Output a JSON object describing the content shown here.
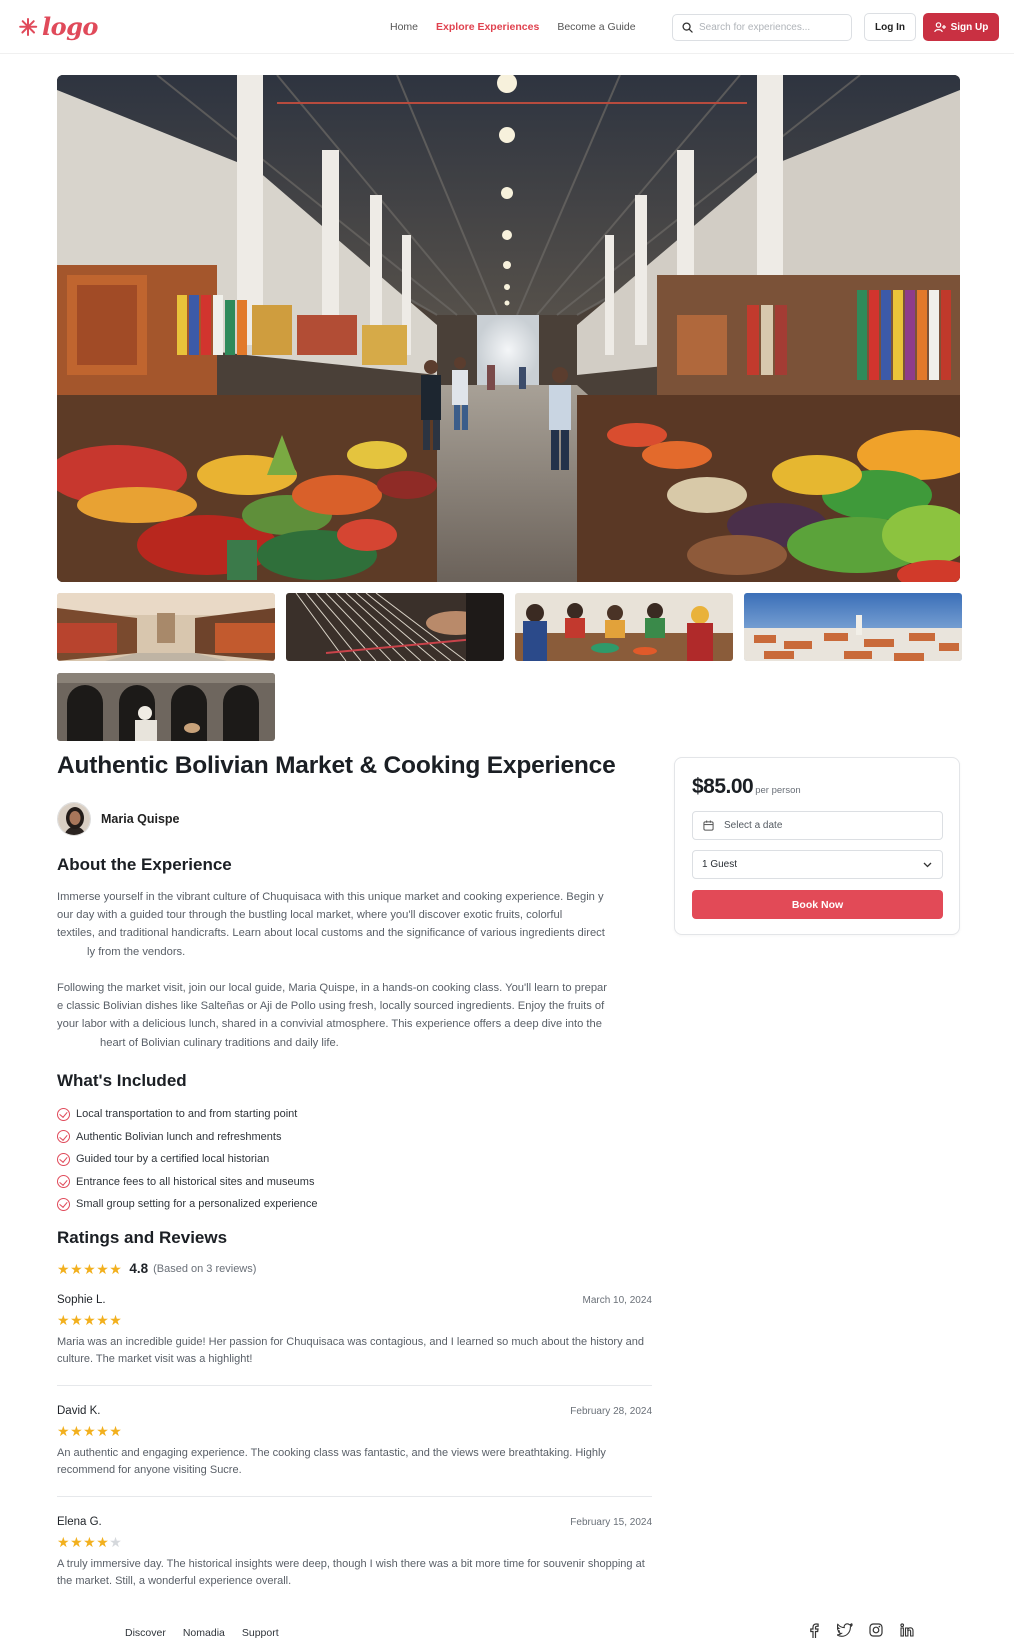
{
  "nav": {
    "logo_text": "logo",
    "links": [
      "Home",
      "Explore Experiences",
      "Become a Guide"
    ],
    "search_placeholder": "Search for experiences...",
    "login_label": "Log In",
    "signup_label": "Sign Up"
  },
  "experience": {
    "title": "Authentic Bolivian Market & Cooking Experience",
    "guide_name": "Maria Quispe"
  },
  "about": {
    "heading": "About the Experience",
    "paragraph_1_lines": [
      "Immerse yourself in the vibrant culture of Chuquisaca with this unique market and cooking experience. Begin y",
      "our day with a guided tour through the bustling local market, where you'll discover exotic fruits, colorful",
      "textiles, and traditional handicrafts. Learn about local customs and the significance of various ingredients direct",
      "ly from the vendors."
    ],
    "paragraph_2_lines": [
      "Following the market visit, join our local guide, Maria Quispe, in a hands-on cooking class. You'll learn to prepar",
      "e classic Bolivian dishes like Salteñas or Aji de Pollo using fresh, locally sourced ingredients. Enjoy the fruits of",
      "your labor with a delicious lunch, shared in a convivial atmosphere. This experience offers a deep dive into the",
      "heart of Bolivian culinary traditions and daily life."
    ]
  },
  "included": {
    "heading": "What's Included",
    "items": [
      "Local transportation to and from starting point",
      "Authentic Bolivian lunch and refreshments",
      "Guided tour by a certified local historian",
      "Entrance fees to all historical sites and museums",
      "Small group setting for a personalized experience"
    ]
  },
  "ratings": {
    "heading": "Ratings and Reviews",
    "average": "4.8",
    "average_stars": 5,
    "count_text": "(Based on 3 reviews)",
    "reviews": [
      {
        "name": "Sophie L.",
        "date": "March 10, 2024",
        "stars": 5,
        "text": "Maria was an incredible guide! Her passion for Chuquisaca was contagious, and I learned so much about the history and culture. The market visit was a highlight!"
      },
      {
        "name": "David K.",
        "date": "February 28, 2024",
        "stars": 5,
        "text": "An authentic and engaging experience. The cooking class was fantastic, and the views were breathtaking. Highly recommend for anyone visiting Sucre."
      },
      {
        "name": "Elena G.",
        "date": "February 15, 2024",
        "stars": 4,
        "text": "A truly immersive day. The historical insights were deep, though I wish there was a bit more time for souvenir shopping at the market. Still, a wonderful experience overall."
      }
    ]
  },
  "booking": {
    "price": "$85.00",
    "price_unit": "per person",
    "date_placeholder": "Select a date",
    "guests_value": "1 Guest",
    "book_label": "Book Now"
  },
  "footer": {
    "links": [
      "Discover",
      "Nomadia",
      "Support"
    ],
    "social_icons": [
      "facebook-icon",
      "twitter-icon",
      "instagram-icon",
      "linkedin-icon"
    ]
  },
  "colors": {
    "accent": "#e24a57",
    "signup": "#c93042",
    "star": "#f2b01e"
  }
}
